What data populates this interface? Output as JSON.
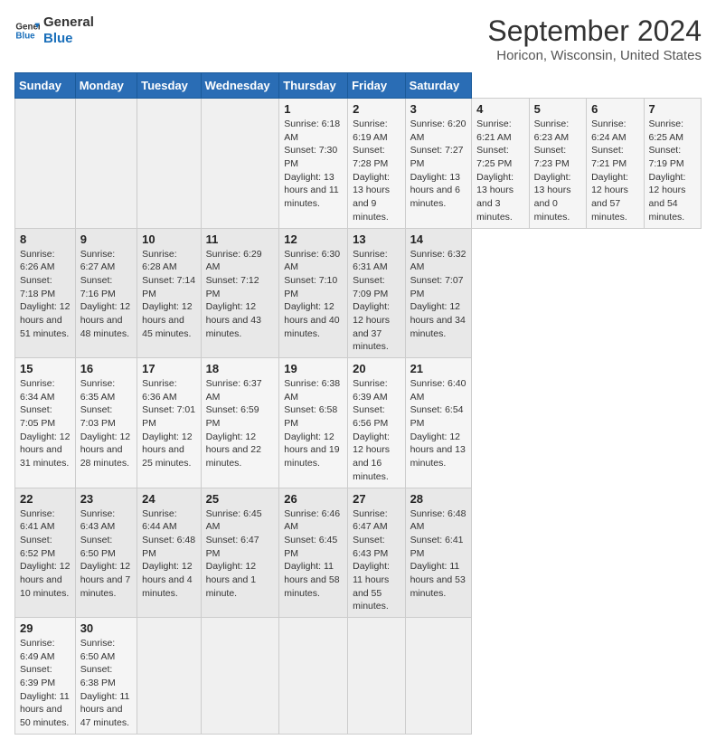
{
  "header": {
    "logo_line1": "General",
    "logo_line2": "Blue",
    "main_title": "September 2024",
    "subtitle": "Horicon, Wisconsin, United States"
  },
  "calendar": {
    "days_of_week": [
      "Sunday",
      "Monday",
      "Tuesday",
      "Wednesday",
      "Thursday",
      "Friday",
      "Saturday"
    ],
    "weeks": [
      [
        null,
        null,
        null,
        null,
        {
          "day": 1,
          "sunrise": "6:18 AM",
          "sunset": "7:30 PM",
          "daylight": "13 hours and 11 minutes."
        },
        {
          "day": 2,
          "sunrise": "6:19 AM",
          "sunset": "7:28 PM",
          "daylight": "13 hours and 9 minutes."
        },
        {
          "day": 3,
          "sunrise": "6:20 AM",
          "sunset": "7:27 PM",
          "daylight": "13 hours and 6 minutes."
        },
        {
          "day": 4,
          "sunrise": "6:21 AM",
          "sunset": "7:25 PM",
          "daylight": "13 hours and 3 minutes."
        },
        {
          "day": 5,
          "sunrise": "6:23 AM",
          "sunset": "7:23 PM",
          "daylight": "13 hours and 0 minutes."
        },
        {
          "day": 6,
          "sunrise": "6:24 AM",
          "sunset": "7:21 PM",
          "daylight": "12 hours and 57 minutes."
        },
        {
          "day": 7,
          "sunrise": "6:25 AM",
          "sunset": "7:19 PM",
          "daylight": "12 hours and 54 minutes."
        }
      ],
      [
        {
          "day": 8,
          "sunrise": "6:26 AM",
          "sunset": "7:18 PM",
          "daylight": "12 hours and 51 minutes."
        },
        {
          "day": 9,
          "sunrise": "6:27 AM",
          "sunset": "7:16 PM",
          "daylight": "12 hours and 48 minutes."
        },
        {
          "day": 10,
          "sunrise": "6:28 AM",
          "sunset": "7:14 PM",
          "daylight": "12 hours and 45 minutes."
        },
        {
          "day": 11,
          "sunrise": "6:29 AM",
          "sunset": "7:12 PM",
          "daylight": "12 hours and 43 minutes."
        },
        {
          "day": 12,
          "sunrise": "6:30 AM",
          "sunset": "7:10 PM",
          "daylight": "12 hours and 40 minutes."
        },
        {
          "day": 13,
          "sunrise": "6:31 AM",
          "sunset": "7:09 PM",
          "daylight": "12 hours and 37 minutes."
        },
        {
          "day": 14,
          "sunrise": "6:32 AM",
          "sunset": "7:07 PM",
          "daylight": "12 hours and 34 minutes."
        }
      ],
      [
        {
          "day": 15,
          "sunrise": "6:34 AM",
          "sunset": "7:05 PM",
          "daylight": "12 hours and 31 minutes."
        },
        {
          "day": 16,
          "sunrise": "6:35 AM",
          "sunset": "7:03 PM",
          "daylight": "12 hours and 28 minutes."
        },
        {
          "day": 17,
          "sunrise": "6:36 AM",
          "sunset": "7:01 PM",
          "daylight": "12 hours and 25 minutes."
        },
        {
          "day": 18,
          "sunrise": "6:37 AM",
          "sunset": "6:59 PM",
          "daylight": "12 hours and 22 minutes."
        },
        {
          "day": 19,
          "sunrise": "6:38 AM",
          "sunset": "6:58 PM",
          "daylight": "12 hours and 19 minutes."
        },
        {
          "day": 20,
          "sunrise": "6:39 AM",
          "sunset": "6:56 PM",
          "daylight": "12 hours and 16 minutes."
        },
        {
          "day": 21,
          "sunrise": "6:40 AM",
          "sunset": "6:54 PM",
          "daylight": "12 hours and 13 minutes."
        }
      ],
      [
        {
          "day": 22,
          "sunrise": "6:41 AM",
          "sunset": "6:52 PM",
          "daylight": "12 hours and 10 minutes."
        },
        {
          "day": 23,
          "sunrise": "6:43 AM",
          "sunset": "6:50 PM",
          "daylight": "12 hours and 7 minutes."
        },
        {
          "day": 24,
          "sunrise": "6:44 AM",
          "sunset": "6:48 PM",
          "daylight": "12 hours and 4 minutes."
        },
        {
          "day": 25,
          "sunrise": "6:45 AM",
          "sunset": "6:47 PM",
          "daylight": "12 hours and 1 minute."
        },
        {
          "day": 26,
          "sunrise": "6:46 AM",
          "sunset": "6:45 PM",
          "daylight": "11 hours and 58 minutes."
        },
        {
          "day": 27,
          "sunrise": "6:47 AM",
          "sunset": "6:43 PM",
          "daylight": "11 hours and 55 minutes."
        },
        {
          "day": 28,
          "sunrise": "6:48 AM",
          "sunset": "6:41 PM",
          "daylight": "11 hours and 53 minutes."
        }
      ],
      [
        {
          "day": 29,
          "sunrise": "6:49 AM",
          "sunset": "6:39 PM",
          "daylight": "11 hours and 50 minutes."
        },
        {
          "day": 30,
          "sunrise": "6:50 AM",
          "sunset": "6:38 PM",
          "daylight": "11 hours and 47 minutes."
        },
        null,
        null,
        null,
        null,
        null
      ]
    ]
  },
  "labels": {
    "sunrise": "Sunrise:",
    "sunset": "Sunset:",
    "daylight": "Daylight:"
  }
}
